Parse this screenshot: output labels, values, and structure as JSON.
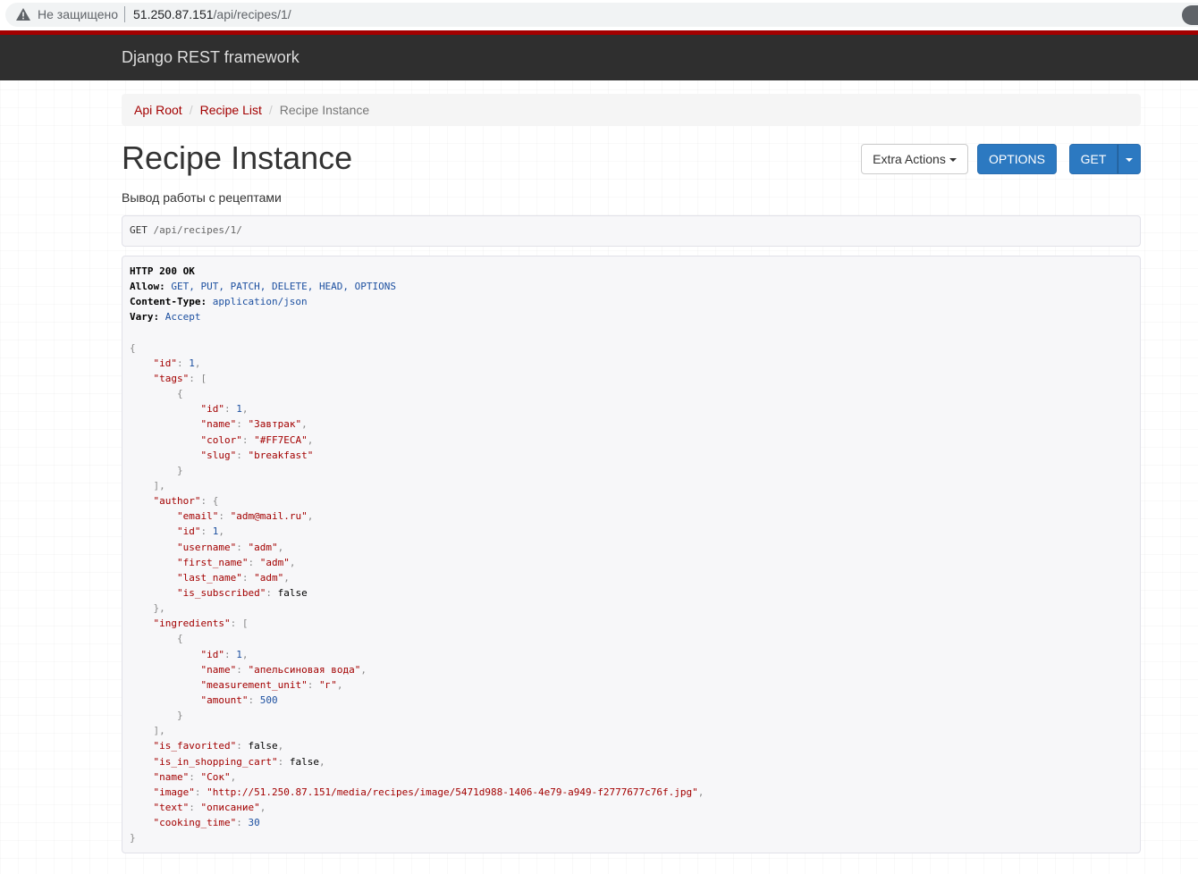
{
  "browser": {
    "security_label": "Не защищено",
    "url_host": "51.250.87.151",
    "url_path": "/api/recipes/1/"
  },
  "navbar": {
    "brand": "Django REST framework"
  },
  "breadcrumb": [
    {
      "label": "Api Root",
      "active": false
    },
    {
      "label": "Recipe List",
      "active": false
    },
    {
      "label": "Recipe Instance",
      "active": true
    }
  ],
  "buttons": {
    "extra_actions": "Extra Actions",
    "options": "OPTIONS",
    "get": "GET"
  },
  "page": {
    "title": "Recipe Instance",
    "description": "Вывод работы с рецептами"
  },
  "request": {
    "method": "GET",
    "path": "/api/recipes/1/"
  },
  "response": {
    "status": "HTTP 200 OK",
    "headers": [
      {
        "name": "Allow:",
        "value": "GET, PUT, PATCH, DELETE, HEAD, OPTIONS"
      },
      {
        "name": "Content-Type:",
        "value": "application/json"
      },
      {
        "name": "Vary:",
        "value": "Accept"
      }
    ],
    "body": [
      [
        [
          "p",
          "{"
        ]
      ],
      [
        [
          "t",
          "    "
        ],
        [
          "k",
          "\"id\""
        ],
        [
          "p",
          ": "
        ],
        [
          "n",
          "1"
        ],
        [
          "p",
          ","
        ]
      ],
      [
        [
          "t",
          "    "
        ],
        [
          "k",
          "\"tags\""
        ],
        [
          "p",
          ": ["
        ]
      ],
      [
        [
          "t",
          "        "
        ],
        [
          "p",
          "{"
        ]
      ],
      [
        [
          "t",
          "            "
        ],
        [
          "k",
          "\"id\""
        ],
        [
          "p",
          ": "
        ],
        [
          "n",
          "1"
        ],
        [
          "p",
          ","
        ]
      ],
      [
        [
          "t",
          "            "
        ],
        [
          "k",
          "\"name\""
        ],
        [
          "p",
          ": "
        ],
        [
          "s",
          "\"Завтрак\""
        ],
        [
          "p",
          ","
        ]
      ],
      [
        [
          "t",
          "            "
        ],
        [
          "k",
          "\"color\""
        ],
        [
          "p",
          ": "
        ],
        [
          "s",
          "\"#FF7ECA\""
        ],
        [
          "p",
          ","
        ]
      ],
      [
        [
          "t",
          "            "
        ],
        [
          "k",
          "\"slug\""
        ],
        [
          "p",
          ": "
        ],
        [
          "s",
          "\"breakfast\""
        ]
      ],
      [
        [
          "t",
          "        "
        ],
        [
          "p",
          "}"
        ]
      ],
      [
        [
          "t",
          "    "
        ],
        [
          "p",
          "],"
        ]
      ],
      [
        [
          "t",
          "    "
        ],
        [
          "k",
          "\"author\""
        ],
        [
          "p",
          ": {"
        ]
      ],
      [
        [
          "t",
          "        "
        ],
        [
          "k",
          "\"email\""
        ],
        [
          "p",
          ": "
        ],
        [
          "s",
          "\"adm@mail.ru\""
        ],
        [
          "p",
          ","
        ]
      ],
      [
        [
          "t",
          "        "
        ],
        [
          "k",
          "\"id\""
        ],
        [
          "p",
          ": "
        ],
        [
          "n",
          "1"
        ],
        [
          "p",
          ","
        ]
      ],
      [
        [
          "t",
          "        "
        ],
        [
          "k",
          "\"username\""
        ],
        [
          "p",
          ": "
        ],
        [
          "s",
          "\"adm\""
        ],
        [
          "p",
          ","
        ]
      ],
      [
        [
          "t",
          "        "
        ],
        [
          "k",
          "\"first_name\""
        ],
        [
          "p",
          ": "
        ],
        [
          "s",
          "\"adm\""
        ],
        [
          "p",
          ","
        ]
      ],
      [
        [
          "t",
          "        "
        ],
        [
          "k",
          "\"last_name\""
        ],
        [
          "p",
          ": "
        ],
        [
          "s",
          "\"adm\""
        ],
        [
          "p",
          ","
        ]
      ],
      [
        [
          "t",
          "        "
        ],
        [
          "k",
          "\"is_subscribed\""
        ],
        [
          "p",
          ": "
        ],
        [
          "b",
          "false"
        ]
      ],
      [
        [
          "t",
          "    "
        ],
        [
          "p",
          "},"
        ]
      ],
      [
        [
          "t",
          "    "
        ],
        [
          "k",
          "\"ingredients\""
        ],
        [
          "p",
          ": ["
        ]
      ],
      [
        [
          "t",
          "        "
        ],
        [
          "p",
          "{"
        ]
      ],
      [
        [
          "t",
          "            "
        ],
        [
          "k",
          "\"id\""
        ],
        [
          "p",
          ": "
        ],
        [
          "n",
          "1"
        ],
        [
          "p",
          ","
        ]
      ],
      [
        [
          "t",
          "            "
        ],
        [
          "k",
          "\"name\""
        ],
        [
          "p",
          ": "
        ],
        [
          "s",
          "\"апельсиновая вода\""
        ],
        [
          "p",
          ","
        ]
      ],
      [
        [
          "t",
          "            "
        ],
        [
          "k",
          "\"measurement_unit\""
        ],
        [
          "p",
          ": "
        ],
        [
          "s",
          "\"г\""
        ],
        [
          "p",
          ","
        ]
      ],
      [
        [
          "t",
          "            "
        ],
        [
          "k",
          "\"amount\""
        ],
        [
          "p",
          ": "
        ],
        [
          "n",
          "500"
        ]
      ],
      [
        [
          "t",
          "        "
        ],
        [
          "p",
          "}"
        ]
      ],
      [
        [
          "t",
          "    "
        ],
        [
          "p",
          "],"
        ]
      ],
      [
        [
          "t",
          "    "
        ],
        [
          "k",
          "\"is_favorited\""
        ],
        [
          "p",
          ": "
        ],
        [
          "b",
          "false"
        ],
        [
          "p",
          ","
        ]
      ],
      [
        [
          "t",
          "    "
        ],
        [
          "k",
          "\"is_in_shopping_cart\""
        ],
        [
          "p",
          ": "
        ],
        [
          "b",
          "false"
        ],
        [
          "p",
          ","
        ]
      ],
      [
        [
          "t",
          "    "
        ],
        [
          "k",
          "\"name\""
        ],
        [
          "p",
          ": "
        ],
        [
          "s",
          "\"Сок\""
        ],
        [
          "p",
          ","
        ]
      ],
      [
        [
          "t",
          "    "
        ],
        [
          "k",
          "\"image\""
        ],
        [
          "p",
          ": "
        ],
        [
          "s",
          "\"http://51.250.87.151/media/recipes/image/5471d988-1406-4e79-a949-f2777677c76f.jpg\""
        ],
        [
          "p",
          ","
        ]
      ],
      [
        [
          "t",
          "    "
        ],
        [
          "k",
          "\"text\""
        ],
        [
          "p",
          ": "
        ],
        [
          "s",
          "\"описание\""
        ],
        [
          "p",
          ","
        ]
      ],
      [
        [
          "t",
          "    "
        ],
        [
          "k",
          "\"cooking_time\""
        ],
        [
          "p",
          ": "
        ],
        [
          "n",
          "30"
        ]
      ],
      [
        [
          "p",
          "}"
        ]
      ]
    ]
  }
}
